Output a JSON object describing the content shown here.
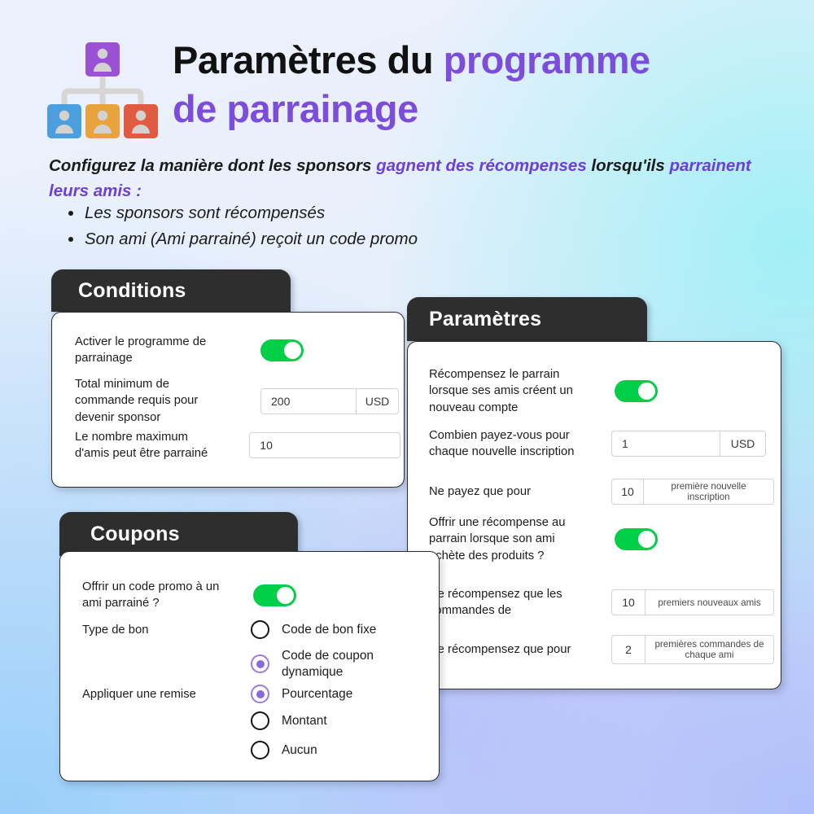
{
  "header": {
    "title_black": "Paramètres du ",
    "title_accent_1": "programme",
    "title_accent_2": "de parrainage",
    "icon_name": "referral-network-icon",
    "subtitle_part_1": "Configurez la manière dont les sponsors ",
    "subtitle_accent_1": "gagnent des récompenses",
    "subtitle_part_2": " lorsqu'ils ",
    "subtitle_accent_2": "parrainent leurs amis",
    "subtitle_part_3": " :",
    "bullets": [
      "Les sponsors sont récompensés",
      "Son ami (Ami parrainé) reçoit un code promo"
    ]
  },
  "colors": {
    "accent_purple": "#7c4ddb",
    "toggle_on_green": "#00cf47",
    "radio_selected_purple": "#8a68de",
    "card_header_dark": "#2e2e2e"
  },
  "cards": {
    "conditions": {
      "title": "Conditions",
      "rows": [
        {
          "label": "Activer le programme de parrainage",
          "control": "toggle",
          "state": "on"
        },
        {
          "label": "Total minimum de commande requis pour devenir sponsor",
          "control": "input-with-suffix",
          "value": "200",
          "suffix": "USD"
        },
        {
          "label": "Le nombre maximum d'amis peut être parrainé",
          "control": "input",
          "value": "10"
        }
      ]
    },
    "parametres": {
      "title": "Paramètres",
      "rows": [
        {
          "label": "Récompensez le parrain lorsque ses amis créent un nouveau compte",
          "control": "toggle",
          "state": "on"
        },
        {
          "label": "Combien payez-vous pour chaque nouvelle inscription",
          "control": "input-with-suffix",
          "value": "1",
          "suffix": "USD"
        },
        {
          "label": "Ne payez que pour",
          "control": "input-with-suffix",
          "value": "10",
          "suffix": "première nouvelle inscription"
        },
        {
          "label": "Offrir une récompense au parrain lorsque son ami achète des produits ?",
          "control": "toggle",
          "state": "on"
        },
        {
          "label": "Ne récompensez que les commandes de",
          "control": "input-with-suffix",
          "value": "10",
          "suffix": "premiers nouveaux amis"
        },
        {
          "label": "Ne récompensez que pour",
          "control": "input-with-suffix",
          "value": "2",
          "suffix": "premières commandes de chaque ami"
        }
      ]
    },
    "coupons": {
      "title": "Coupons",
      "rows": [
        {
          "label": "Offrir un code promo à un ami parrainé ?",
          "control": "toggle",
          "state": "on"
        },
        {
          "label": "Type de bon",
          "control": "radio-group"
        },
        {
          "label": "Appliquer une remise",
          "control": "radio-group"
        }
      ],
      "radio_options": [
        {
          "label": "Code de bon fixe",
          "selected": false
        },
        {
          "label": "Code de coupon dynamique",
          "selected": true
        },
        {
          "label": "Pourcentage",
          "selected": true
        },
        {
          "label": "Montant",
          "selected": false
        },
        {
          "label": "Aucun",
          "selected": false
        }
      ]
    }
  }
}
